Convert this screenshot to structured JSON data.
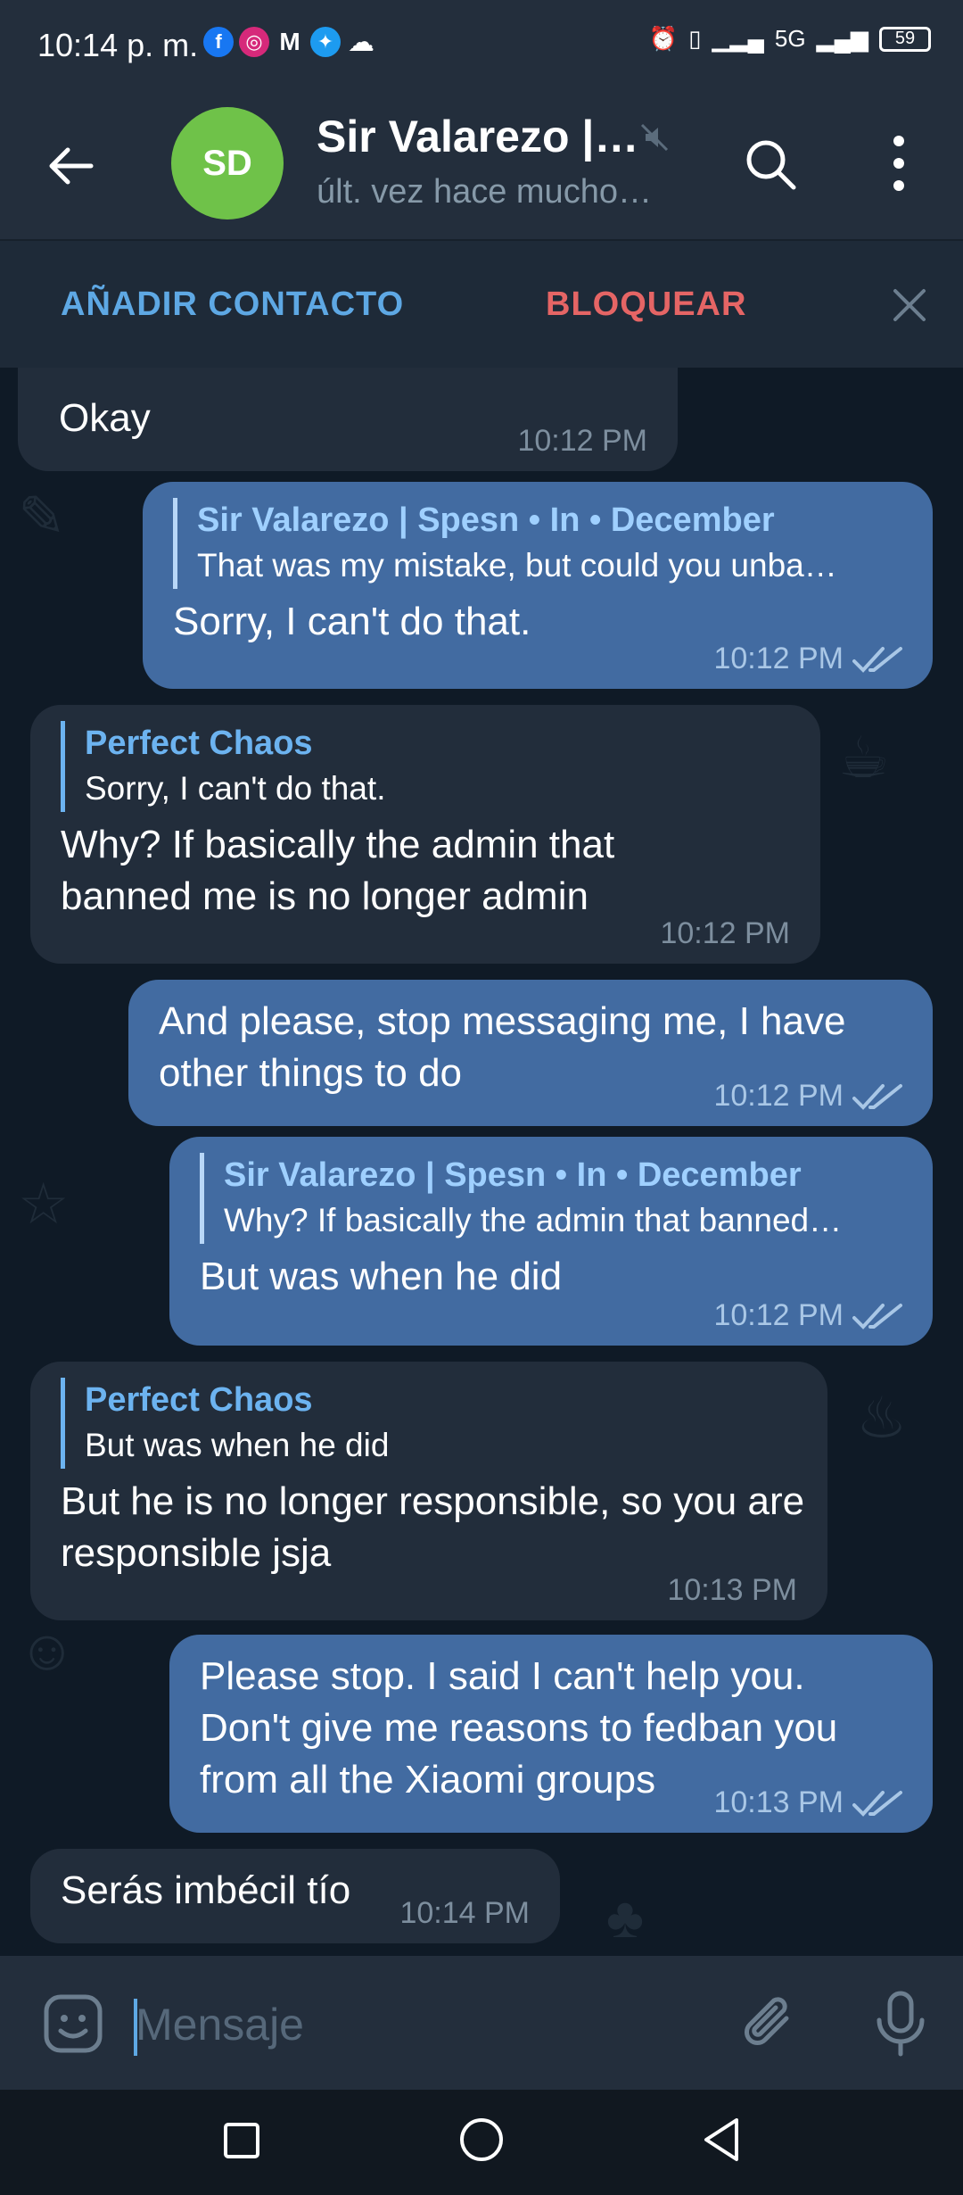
{
  "status_bar": {
    "time": "10:14 p. m.",
    "network": "5G",
    "battery": "59"
  },
  "header": {
    "avatar_initials": "SD",
    "title": "Sir Valarezo |…",
    "status": "últ. vez hace mucho…"
  },
  "action_bar": {
    "add_contact": "AÑADIR CONTACTO",
    "block": "BLOQUEAR"
  },
  "messages": [
    {
      "dir": "in",
      "text": "Okay",
      "time": "10:12 PM"
    },
    {
      "dir": "out",
      "reply_name": "Sir Valarezo | Spesn • In • December",
      "reply_text": "That was my mistake, but could you unba…",
      "text": "Sorry, I can't do that.",
      "time": "10:12 PM"
    },
    {
      "dir": "in",
      "reply_name": "Perfect Chaos",
      "reply_text": "Sorry, I can't do that.",
      "text": "Why? If basically the admin that banned me is no longer admin",
      "time": "10:12 PM"
    },
    {
      "dir": "out",
      "text": "And please, stop messaging me, I have other things to do",
      "time": "10:12 PM"
    },
    {
      "dir": "out",
      "reply_name": "Sir Valarezo | Spesn • In • December",
      "reply_text": "Why? If basically the admin that banned…",
      "text": "But was when he did",
      "time": "10:12 PM"
    },
    {
      "dir": "in",
      "reply_name": "Perfect Chaos",
      "reply_text": "But was when he did",
      "text": "But he is no longer responsible, so you are responsible jsja",
      "time": "10:13 PM"
    },
    {
      "dir": "out",
      "text": "Please stop. I said I can't help you. Don't give me reasons to fedban you from all the Xiaomi groups",
      "time": "10:13 PM"
    },
    {
      "dir": "in",
      "text": "Serás imbécil tío",
      "time": "10:14 PM"
    }
  ],
  "composer": {
    "placeholder": "Mensaje"
  },
  "colors": {
    "header_bg": "#232e3c",
    "chat_bg": "#0f1a26",
    "incoming_bubble": "#222d3b",
    "outgoing_bubble": "#426ba1",
    "accent_blue": "#5ea8e4",
    "danger_red": "#e56565",
    "avatar_green": "#6fc249"
  }
}
